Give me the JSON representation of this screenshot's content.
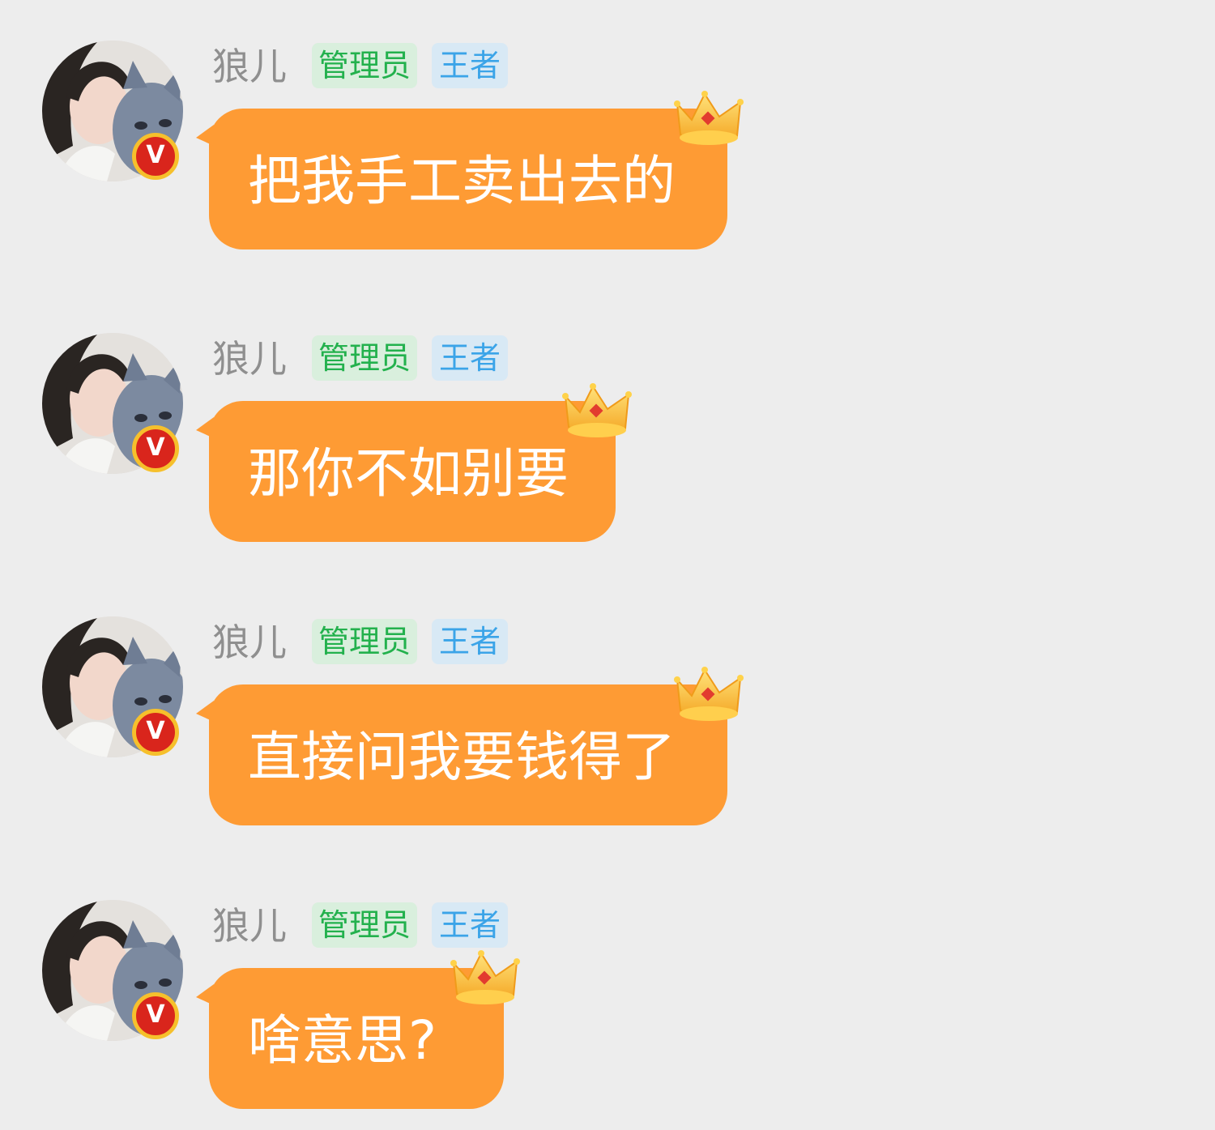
{
  "messages": [
    {
      "sender": "狼儿",
      "role_tag": "管理员",
      "rank_tag": "王者",
      "badge": "V",
      "text": "把我手工卖出去的"
    },
    {
      "sender": "狼儿",
      "role_tag": "管理员",
      "rank_tag": "王者",
      "badge": "V",
      "text": "那你不如别要"
    },
    {
      "sender": "狼儿",
      "role_tag": "管理员",
      "rank_tag": "王者",
      "badge": "V",
      "text": "直接问我要钱得了"
    },
    {
      "sender": "狼儿",
      "role_tag": "管理员",
      "rank_tag": "王者",
      "badge": "V",
      "text": "啥意思?"
    }
  ],
  "colors": {
    "background": "#ededed",
    "bubble": "#fe9b34",
    "admin_tag_bg": "#d9efdd",
    "admin_tag_text": "#23b14d",
    "rank_tag_bg": "#d8e9f5",
    "rank_tag_text": "#3ba4e8",
    "badge": "#d9251c",
    "badge_ring": "#f6c02c"
  },
  "icons": {
    "avatar": "user-avatar-photo",
    "verified_badge": "v-badge-icon",
    "bubble_decoration": "crown-icon"
  }
}
